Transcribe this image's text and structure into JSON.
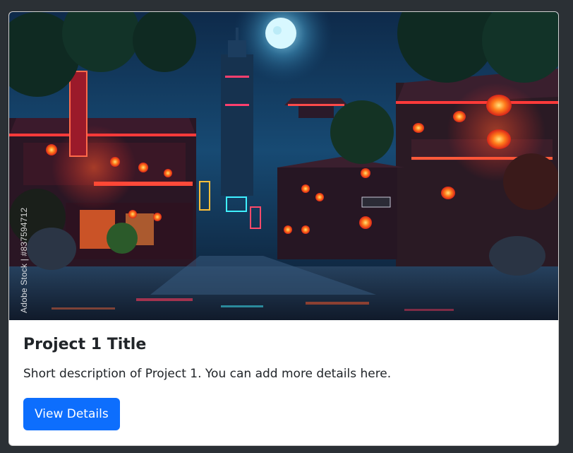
{
  "card": {
    "image_alt": "Neon-lit night street in an asian-style town under a full moon",
    "watermark": "Adobe Stock | #837594712",
    "title": "Project 1 Title",
    "description": "Short description of Project 1. You can add more details here.",
    "button_label": "View Details"
  },
  "colors": {
    "page_bg": "#2b3035",
    "card_bg": "#ffffff",
    "primary": "#0d6efd",
    "text": "#212529"
  }
}
